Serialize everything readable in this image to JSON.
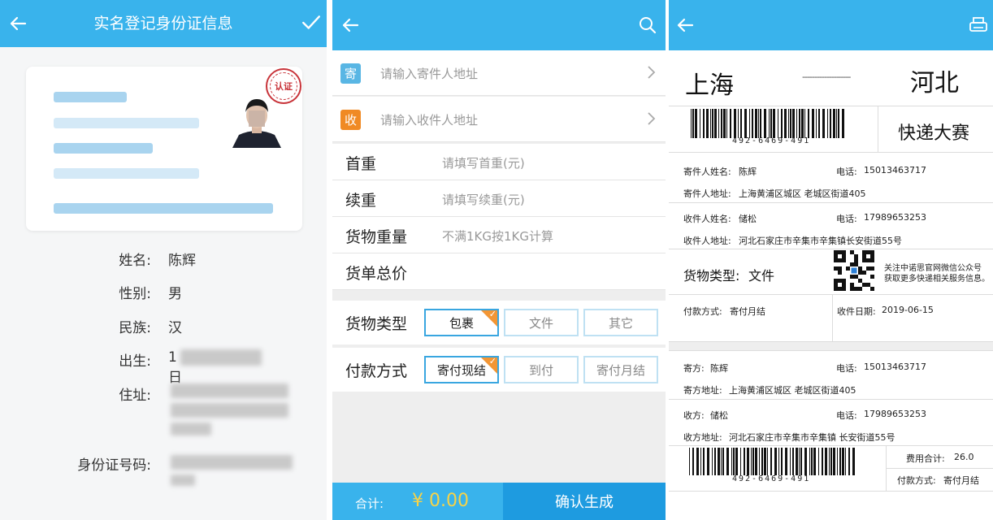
{
  "colors": {
    "accent": "#39b3ec",
    "accent_dark": "#1e9be0",
    "orange": "#f39634",
    "seal_red": "#c8343a",
    "price": "#f7d348"
  },
  "panel1": {
    "header": {
      "back_icon": "arrow-left-icon",
      "title": "实名登记身份证信息",
      "confirm_icon": "check-icon"
    },
    "seal_text": "认证",
    "fields": [
      {
        "label": "姓名:",
        "value": "陈辉"
      },
      {
        "label": "性别:",
        "value": "男"
      },
      {
        "label": "民族:",
        "value": "汉"
      },
      {
        "label": "出生:",
        "value": "1 日"
      },
      {
        "label": "住址:",
        "value": ""
      },
      {
        "label": "身份证号码:",
        "value": ""
      }
    ]
  },
  "panel2": {
    "header": {
      "back_icon": "arrow-left-icon",
      "search_icon": "search-icon"
    },
    "sender": {
      "badge": "寄",
      "placeholder": "请输入寄件人地址"
    },
    "receiver": {
      "badge": "收",
      "placeholder": "请输入收件人地址"
    },
    "rows": [
      {
        "label": "首重",
        "placeholder": "请填写首重(元)"
      },
      {
        "label": "续重",
        "placeholder": "请填写续重(元)"
      },
      {
        "label": "货物重量",
        "placeholder": "不满1KG按1KG计算"
      },
      {
        "label": "货单总价",
        "placeholder": ""
      }
    ],
    "cargo_type": {
      "label": "货物类型",
      "options": [
        "包裹",
        "文件",
        "其它"
      ],
      "selected": 0
    },
    "payment": {
      "label": "付款方式",
      "options": [
        "寄付现结",
        "到付",
        "寄付月结"
      ],
      "selected": 0
    },
    "footer": {
      "total_label": "合计:",
      "total_value": "¥ 0.00",
      "confirm": "确认生成"
    }
  },
  "panel3": {
    "header": {
      "back_icon": "arrow-left-icon",
      "print_icon": "printer-icon"
    },
    "from_city": "上海",
    "to_city": "河北",
    "route_line": "--------------------",
    "barcode_number": "492-6469-491",
    "brand": "快递大赛",
    "sender_name_label": "寄件人姓名:",
    "sender_name": "陈辉",
    "sender_phone_label": "电话:",
    "sender_phone": "15013463717",
    "sender_addr_label": "寄件人地址:",
    "sender_addr": "上海黄浦区城区 老城区街道405",
    "recv_name_label": "收件人姓名:",
    "recv_name": "储松",
    "recv_phone_label": "电话:",
    "recv_phone": "17989653253",
    "recv_addr_label": "收件人地址:",
    "recv_addr": "河北石家庄市辛集市辛集镇长安街道55号",
    "cargo_label": "货物类型:",
    "cargo_value": "文件",
    "qr_note_1": "关注中诺思官网微信公众号",
    "qr_note_2": "获取更多快递相关服务信息。",
    "pay_label": "付款方式:",
    "pay_value": "寄付月结",
    "date_label": "收件日期:",
    "date_value": "2019-06-15",
    "stub": {
      "sender_label": "寄方:",
      "sender": "陈辉",
      "sender_phone_label": "电话:",
      "sender_phone": "15013463717",
      "sender_addr_label": "寄方地址:",
      "sender_addr": "上海黄浦区城区 老城区街道405",
      "recv_label": "收方:",
      "recv": "储松",
      "recv_phone_label": "电话:",
      "recv_phone": "17989653253",
      "recv_addr_label": "收方地址:",
      "recv_addr": "河北石家庄市辛集市辛集镇 长安街道55号",
      "fee_label": "费用合计:",
      "fee": "26.0",
      "pay_label": "付款方式:",
      "pay": "寄付月结"
    }
  }
}
